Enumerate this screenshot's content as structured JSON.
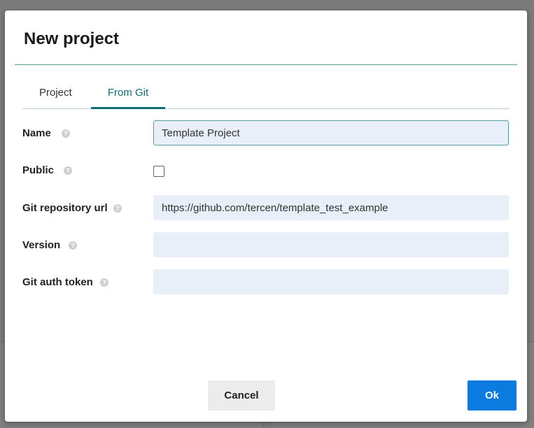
{
  "dialog": {
    "title": "New project",
    "tabs": [
      {
        "label": "Project",
        "active": false
      },
      {
        "label": "From Git",
        "active": true
      }
    ],
    "fields": {
      "name": {
        "label": "Name",
        "value": "Template Project"
      },
      "public": {
        "label": "Public",
        "checked": false
      },
      "git_url": {
        "label": "Git repository url",
        "value": "https://github.com/tercen/template_test_example"
      },
      "version": {
        "label": "Version",
        "value": ""
      },
      "auth_token": {
        "label": "Git auth token",
        "value": ""
      }
    },
    "buttons": {
      "cancel": "Cancel",
      "ok": "Ok"
    }
  },
  "colors": {
    "accent": "#0f6e73",
    "primary_button": "#0b7be0",
    "field_bg": "#e8eff8"
  }
}
